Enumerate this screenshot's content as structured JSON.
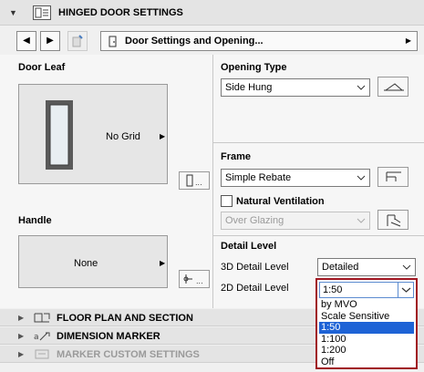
{
  "header": {
    "title": "HINGED DOOR SETTINGS"
  },
  "nav": {
    "selector_label": "Door Settings and Opening..."
  },
  "door_leaf": {
    "label": "Door Leaf",
    "preview_text": "No Grid"
  },
  "handle": {
    "label": "Handle",
    "preview_text": "None"
  },
  "opening_type": {
    "label": "Opening Type",
    "value": "Side Hung"
  },
  "frame": {
    "label": "Frame",
    "value": "Simple Rebate"
  },
  "natural_ventilation": {
    "label": "Natural Ventilation",
    "checked": false,
    "value": "Over Glazing"
  },
  "detail_level": {
    "label": "Detail Level",
    "detail_3d_label": "3D Detail Level",
    "detail_3d_value": "Detailed",
    "detail_2d_label": "2D Detail Level",
    "detail_2d_value": "1:50",
    "detail_2d_options": [
      "by MVO",
      "Scale Sensitive",
      "1:50",
      "1:100",
      "1:200",
      "Off"
    ],
    "highlighted_option": "1:50"
  },
  "collapsed_sections": [
    {
      "title": "FLOOR PLAN AND SECTION"
    },
    {
      "title": "DIMENSION MARKER"
    },
    {
      "title": "MARKER CUSTOM SETTINGS"
    }
  ],
  "colors": {
    "highlight": "#1e63d6",
    "focus_border": "#a01520",
    "door_frame": "#5a5a5a",
    "door_glass": "#e8eef2"
  }
}
